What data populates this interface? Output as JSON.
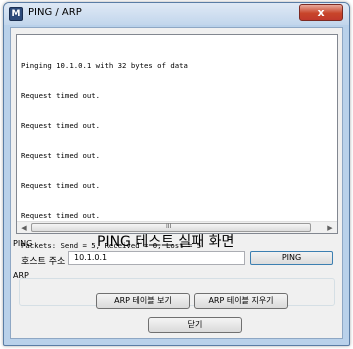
{
  "window": {
    "title": "PING / ARP",
    "icon_letter": "M",
    "close_label": "x"
  },
  "output": {
    "lines": [
      "Pinging 10.1.0.1 with 32 bytes of data",
      "Request timed out.",
      "Request timed out.",
      "Request timed out.",
      "Request timed out.",
      "Request timed out.",
      "Packets: Send = 5, Received = 0, Lost = 5"
    ],
    "scroll_grip": "III"
  },
  "ping_group": {
    "label": "PING",
    "host_label": "호스트 주소",
    "host_value": "10.1.0.1",
    "ping_button": "PING"
  },
  "caption": "PING 테스트 실패 화면",
  "arp_group": {
    "label": "ARP",
    "view_button": "ARP 테이블 보기",
    "clear_button": "ARP 테이블 지우기"
  },
  "close_button": "닫기"
}
